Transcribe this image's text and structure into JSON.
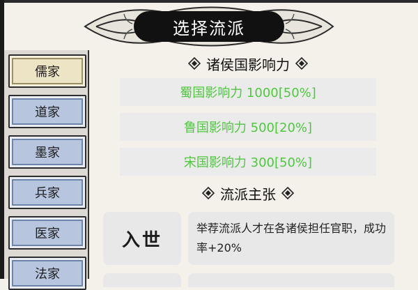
{
  "title": "选择流派",
  "sidebar": {
    "items": [
      {
        "label": "儒家",
        "active": true
      },
      {
        "label": "道家",
        "active": false
      },
      {
        "label": "墨家",
        "active": false
      },
      {
        "label": "兵家",
        "active": false
      },
      {
        "label": "医家",
        "active": false
      },
      {
        "label": "法家",
        "active": false
      }
    ]
  },
  "influence": {
    "heading": "诸侯国影响力",
    "rows": [
      "蜀国影响力 1000[50%]",
      "鲁国影响力 500[20%]",
      "宋国影响力 300[50%]"
    ],
    "text_color": "#4fc73f"
  },
  "doctrine": {
    "heading": "流派主张",
    "items": [
      {
        "name": "入世",
        "description": "举荐流派人才在各诸侯担任官职，成功率+20%"
      }
    ]
  },
  "icons": {
    "section_ornament": "spiral-ornament-icon"
  },
  "colors": {
    "title_plate": "#111111",
    "sidebar_item": "#b7c5df",
    "sidebar_item_active": "#ede3c5",
    "panel": "#ebebeb",
    "background": "#f3f1ea"
  }
}
